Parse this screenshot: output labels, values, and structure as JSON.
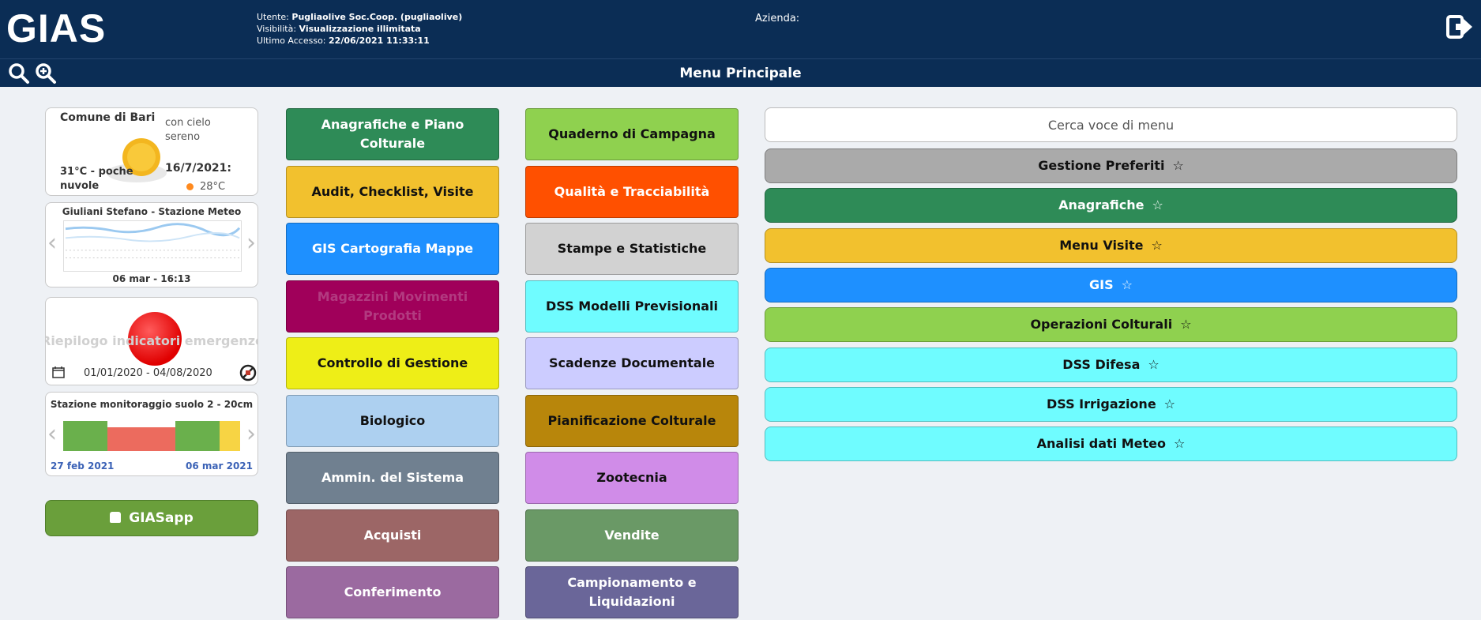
{
  "header": {
    "logo": "GIAS",
    "user_label": "Utente:",
    "user_value": "Pugliaolive Soc.Coop. (pugliaolive)",
    "visibility_label": "Visibilità:",
    "visibility_value": "Visualizzazione illimitata",
    "last_access_label": "Ultimo Accesso:",
    "last_access_value": "22/06/2021 11:33:11",
    "azienda_label": "Azienda:"
  },
  "menubar": {
    "title": "Menu Principale"
  },
  "weather": {
    "city": "Comune di Bari",
    "condition": "con cielo sereno",
    "current": "31°C - poche nuvole",
    "next_date": "16/7/2021:",
    "next_temp": "28°C"
  },
  "meteo_station": {
    "title": "Giuliani Stefano - Stazione Meteo",
    "timestamp": "06 mar - 16:13"
  },
  "emergencies": {
    "title": "Riepilogo indicatori emergenze D",
    "dates": "01/01/2020 - 04/08/2020"
  },
  "soil_station": {
    "title": "Stazione monitoraggio suolo 2 - 20cm",
    "date_from": "27 feb 2021",
    "date_to": "06 mar 2021"
  },
  "app_button": {
    "label": "GIASapp"
  },
  "tiles": {
    "col1": [
      {
        "label": "Anagrafiche e Piano Colturale",
        "bg": "#2e8b57",
        "fg": "#ffffff"
      },
      {
        "label": "Audit, Checklist, Visite",
        "bg": "#f2c12e",
        "fg": "#111111"
      },
      {
        "label": "GIS Cartografia Mappe",
        "bg": "#1e90ff",
        "fg": "#ffffff"
      },
      {
        "label": "Magazzini Movimenti Prodotti",
        "bg": "#a0005a",
        "fg": "#b23a80"
      },
      {
        "label": "Controllo di Gestione",
        "bg": "#eeee17",
        "fg": "#111111"
      },
      {
        "label": "Biologico",
        "bg": "#add0f0",
        "fg": "#111111"
      },
      {
        "label": "Ammin. del Sistema",
        "bg": "#708090",
        "fg": "#ffffff"
      },
      {
        "label": "Acquisti",
        "bg": "#9c6666",
        "fg": "#ffffff"
      },
      {
        "label": "Conferimento",
        "bg": "#9b6aa0",
        "fg": "#ffffff"
      }
    ],
    "col2": [
      {
        "label": "Quaderno di Campagna",
        "bg": "#8fd14f",
        "fg": "#111111"
      },
      {
        "label": "Qualità e Tracciabilità",
        "bg": "#ff5000",
        "fg": "#ffffff"
      },
      {
        "label": "Stampe e Statistiche",
        "bg": "#d2d2d2",
        "fg": "#111111"
      },
      {
        "label": "DSS Modelli Previsionali",
        "bg": "#6ffcff",
        "fg": "#111111"
      },
      {
        "label": "Scadenze Documentale",
        "bg": "#ccccff",
        "fg": "#111111"
      },
      {
        "label": "Pianificazione Colturale",
        "bg": "#b8860b",
        "fg": "#111111"
      },
      {
        "label": "Zootecnia",
        "bg": "#d08ce8",
        "fg": "#111111"
      },
      {
        "label": "Vendite",
        "bg": "#6a9966",
        "fg": "#ffffff"
      },
      {
        "label": "Campionamento e Liquidazioni",
        "bg": "#6a6699",
        "fg": "#ffffff"
      }
    ]
  },
  "search": {
    "placeholder": "Cerca voce di menu"
  },
  "favorites": [
    {
      "label": "Gestione Preferiti",
      "bg": "#aaaaaa",
      "fg": "#111111"
    },
    {
      "label": "Anagrafiche",
      "bg": "#2e8b57",
      "fg": "#ffffff"
    },
    {
      "label": "Menu Visite",
      "bg": "#f2c12e",
      "fg": "#111111"
    },
    {
      "label": "GIS",
      "bg": "#1e90ff",
      "fg": "#ffffff"
    },
    {
      "label": "Operazioni Colturali",
      "bg": "#8fd14f",
      "fg": "#111111"
    },
    {
      "label": "DSS Difesa",
      "bg": "#6ffcff",
      "fg": "#111111"
    },
    {
      "label": "DSS Irrigazione",
      "bg": "#6ffcff",
      "fg": "#111111"
    },
    {
      "label": "Analisi dati Meteo",
      "bg": "#6ffcff",
      "fg": "#111111"
    }
  ],
  "star_glyph": "☆"
}
